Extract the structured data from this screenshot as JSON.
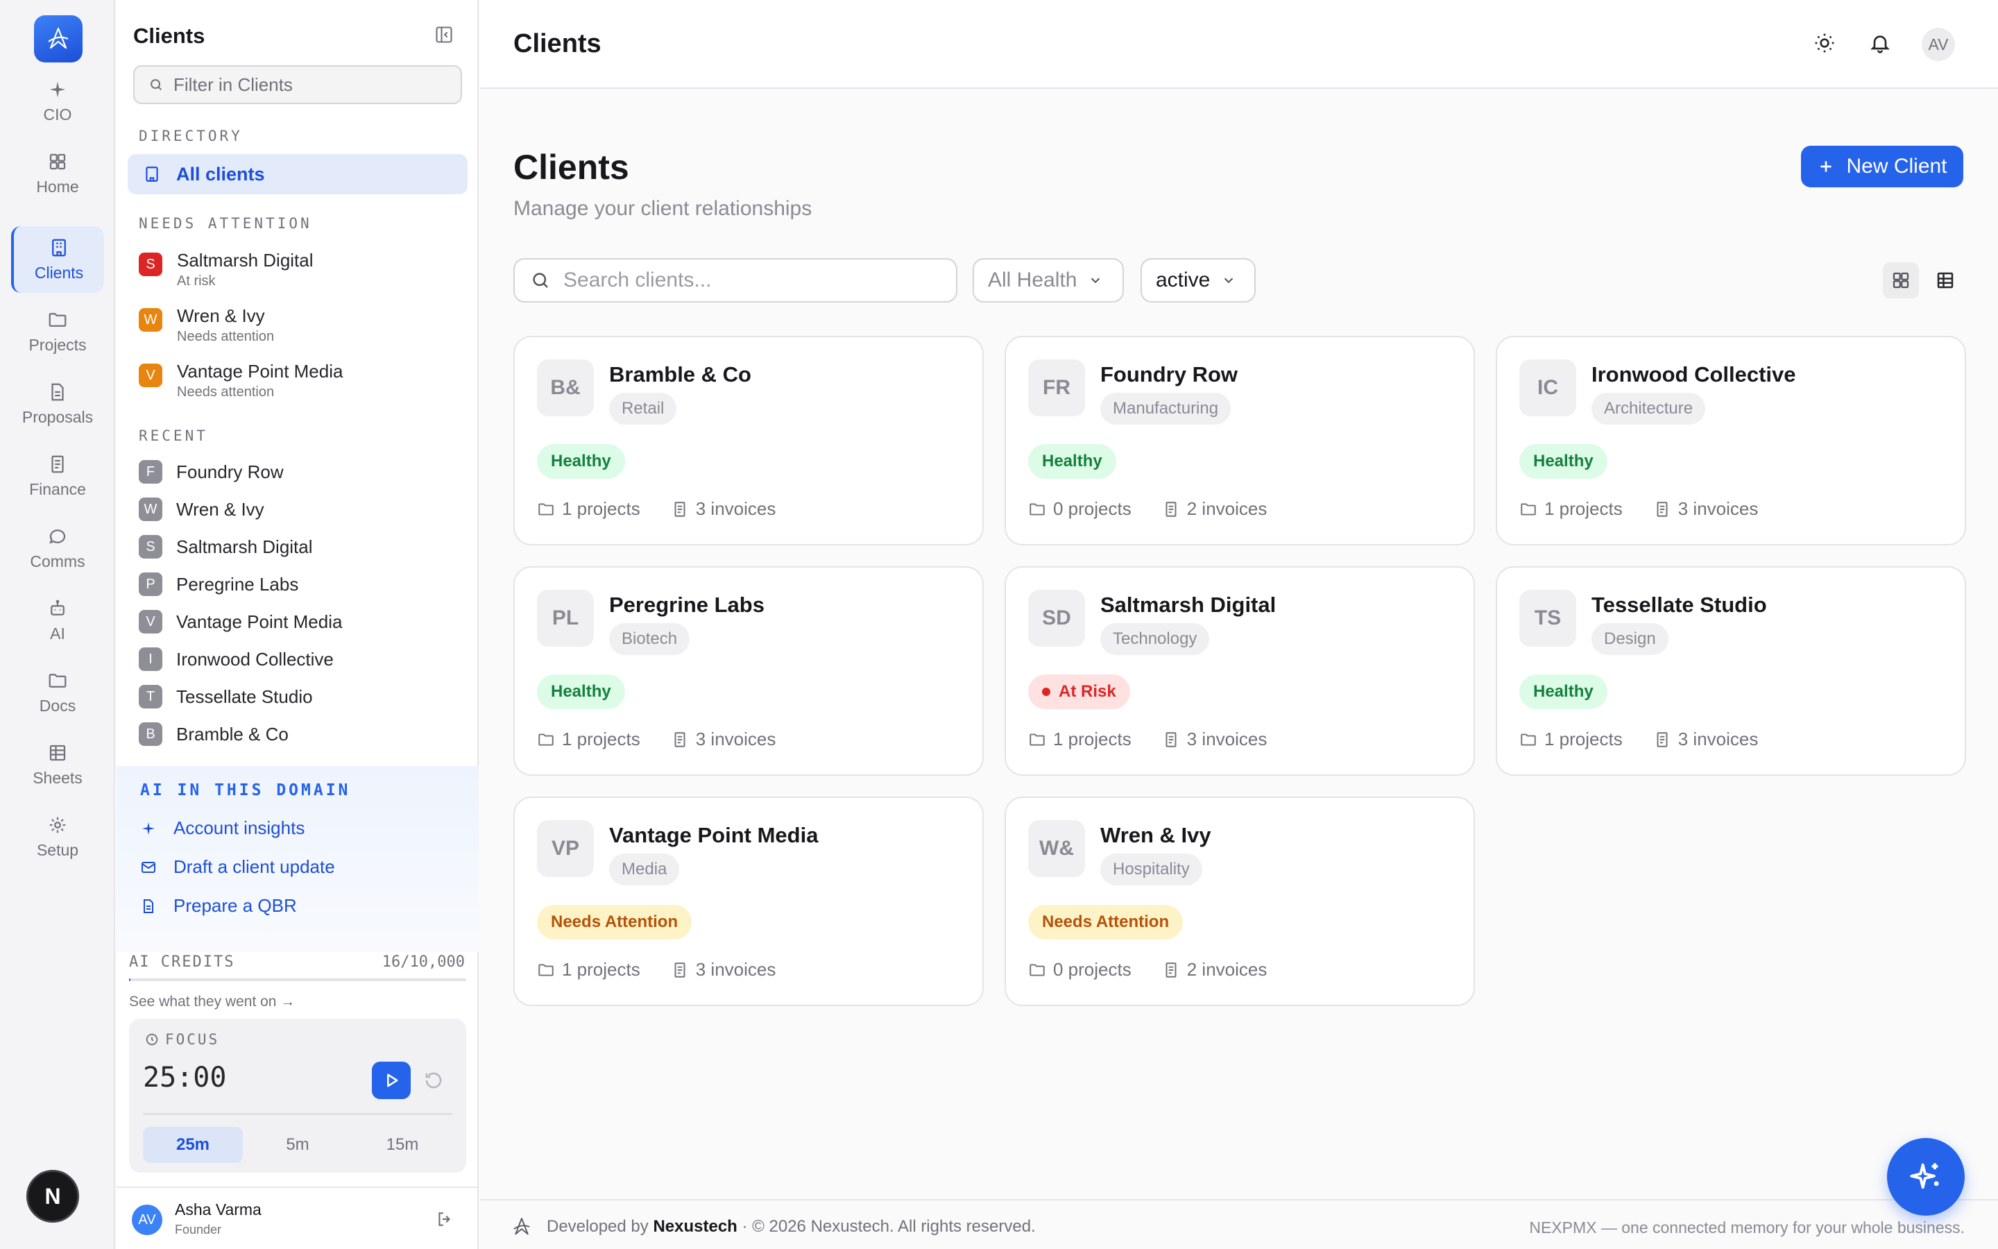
{
  "rail": {
    "items": [
      {
        "label": "CIO",
        "icon": "sparkle-icon"
      },
      {
        "label": "Home",
        "icon": "grid-icon"
      },
      {
        "label": "Clients",
        "icon": "building-icon",
        "active": true
      },
      {
        "label": "Projects",
        "icon": "folder-icon"
      },
      {
        "label": "Proposals",
        "icon": "document-icon"
      },
      {
        "label": "Finance",
        "icon": "receipt-icon"
      },
      {
        "label": "Comms",
        "icon": "chat-icon"
      },
      {
        "label": "AI",
        "icon": "robot-icon"
      },
      {
        "label": "Docs",
        "icon": "folder-icon"
      },
      {
        "label": "Sheets",
        "icon": "table-icon"
      },
      {
        "label": "Setup",
        "icon": "gear-icon"
      }
    ],
    "n_button": "N"
  },
  "panel": {
    "title": "Clients",
    "filter_placeholder": "Filter in Clients",
    "directory_label": "DIRECTORY",
    "all_clients": "All clients",
    "attention_label": "NEEDS ATTENTION",
    "attention": [
      {
        "initial": "S",
        "name": "Saltmarsh Digital",
        "status": "At risk",
        "color": "#dc2626"
      },
      {
        "initial": "W",
        "name": "Wren & Ivy",
        "status": "Needs attention",
        "color": "#e8850f"
      },
      {
        "initial": "V",
        "name": "Vantage Point Media",
        "status": "Needs attention",
        "color": "#e8850f"
      }
    ],
    "recent_label": "RECENT",
    "recent": [
      {
        "initial": "F",
        "name": "Foundry Row"
      },
      {
        "initial": "W",
        "name": "Wren & Ivy"
      },
      {
        "initial": "S",
        "name": "Saltmarsh Digital"
      },
      {
        "initial": "P",
        "name": "Peregrine Labs"
      },
      {
        "initial": "V",
        "name": "Vantage Point Media"
      },
      {
        "initial": "I",
        "name": "Ironwood Collective"
      },
      {
        "initial": "T",
        "name": "Tessellate Studio"
      },
      {
        "initial": "B",
        "name": "Bramble & Co"
      }
    ],
    "ai_label": "AI IN THIS DOMAIN",
    "ai_links": [
      {
        "label": "Account insights",
        "icon": "sparkle-icon"
      },
      {
        "label": "Draft a client update",
        "icon": "mail-icon"
      },
      {
        "label": "Prepare a QBR",
        "icon": "document-icon"
      }
    ],
    "credits_label": "AI CREDITS",
    "credits_value": "16/10,000",
    "credits_fraction": 0.0016,
    "see_what": "See what they went on →",
    "focus": {
      "label": "FOCUS",
      "time": "25:00",
      "durations": [
        "25m",
        "5m",
        "15m"
      ],
      "selected": "25m"
    },
    "user": {
      "initials": "AV",
      "name": "Asha Varma",
      "role": "Founder"
    }
  },
  "topbar": {
    "title": "Clients",
    "avatar": "AV"
  },
  "main": {
    "title": "Clients",
    "subtitle": "Manage your client relationships",
    "new_button": "New Client",
    "search_placeholder": "Search clients...",
    "health_filter": "All Health",
    "status_filter": "active"
  },
  "clients": [
    {
      "initials": "B&",
      "name": "Bramble & Co",
      "industry": "Retail",
      "health": "Healthy",
      "health_kind": "healthy",
      "projects": "1 projects",
      "invoices": "3 invoices"
    },
    {
      "initials": "FR",
      "name": "Foundry Row",
      "industry": "Manufacturing",
      "health": "Healthy",
      "health_kind": "healthy",
      "projects": "0 projects",
      "invoices": "2 invoices"
    },
    {
      "initials": "IC",
      "name": "Ironwood Collective",
      "industry": "Architecture",
      "health": "Healthy",
      "health_kind": "healthy",
      "projects": "1 projects",
      "invoices": "3 invoices"
    },
    {
      "initials": "PL",
      "name": "Peregrine Labs",
      "industry": "Biotech",
      "health": "Healthy",
      "health_kind": "healthy",
      "projects": "1 projects",
      "invoices": "3 invoices"
    },
    {
      "initials": "SD",
      "name": "Saltmarsh Digital",
      "industry": "Technology",
      "health": "At Risk",
      "health_kind": "risk",
      "projects": "1 projects",
      "invoices": "3 invoices"
    },
    {
      "initials": "TS",
      "name": "Tessellate Studio",
      "industry": "Design",
      "health": "Healthy",
      "health_kind": "healthy",
      "projects": "1 projects",
      "invoices": "3 invoices"
    },
    {
      "initials": "VP",
      "name": "Vantage Point Media",
      "industry": "Media",
      "health": "Needs Attention",
      "health_kind": "attn",
      "projects": "1 projects",
      "invoices": "3 invoices"
    },
    {
      "initials": "W&",
      "name": "Wren & Ivy",
      "industry": "Hospitality",
      "health": "Needs Attention",
      "health_kind": "attn",
      "projects": "0 projects",
      "invoices": "2 invoices"
    }
  ],
  "footer": {
    "developed_by": "Developed by",
    "company": "Nexustech",
    "copyright": "· © 2026 Nexustech. All rights reserved.",
    "tagline": "NEXPMX — one connected memory for your whole business."
  },
  "colors": {
    "accent": "#2563eb",
    "healthy": "#15803d",
    "risk": "#dc2626",
    "attention": "#b45309"
  }
}
